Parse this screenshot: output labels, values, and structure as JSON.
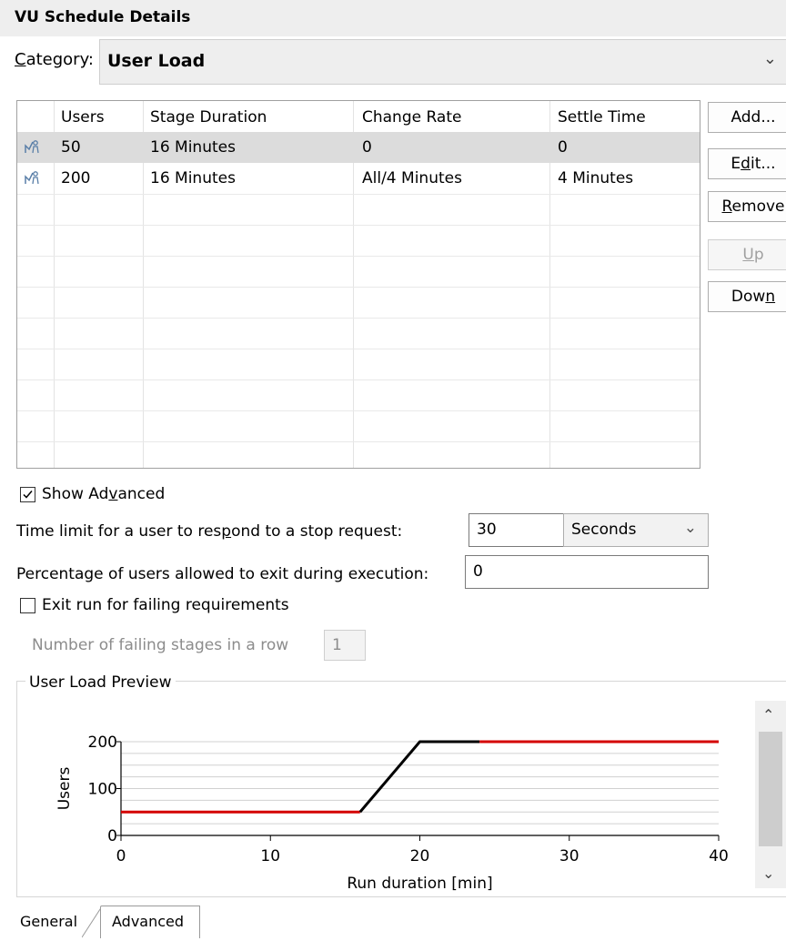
{
  "header": {
    "title": "VU Schedule Details"
  },
  "category": {
    "label": "Category:",
    "value": "User Load"
  },
  "table": {
    "columns": [
      "Users",
      "Stage Duration",
      "Change Rate",
      "Settle Time"
    ],
    "rows": [
      {
        "users": "50",
        "duration": "16 Minutes",
        "change_rate": "0",
        "settle": "0",
        "selected": true
      },
      {
        "users": "200",
        "duration": "16 Minutes",
        "change_rate": "All/4 Minutes",
        "settle": "4 Minutes",
        "selected": false
      }
    ]
  },
  "buttons": {
    "add": "Add...",
    "edit": "Edit...",
    "remove": "Remove",
    "up": "Up",
    "down": "Down"
  },
  "advanced": {
    "show_advanced_label": "Show Advanced",
    "show_advanced_checked": true,
    "stop_time_label": "Time limit for a user to respond to a stop request:",
    "stop_time_value": "30",
    "stop_time_unit": "Seconds",
    "exit_pct_label": "Percentage of users allowed to exit during execution:",
    "exit_pct_value": "0",
    "exit_failing_label": "Exit run for failing requirements",
    "exit_failing_checked": false,
    "failing_stages_label": "Number of failing stages in a row",
    "failing_stages_value": "1"
  },
  "preview": {
    "title": "User Load Preview",
    "scroll_up": "^",
    "scroll_down": "v"
  },
  "chart_data": {
    "type": "line",
    "ylabel": "Users",
    "xlabel": "Run duration [min]",
    "x_ticks": [
      "0",
      "10",
      "20",
      "30",
      "40"
    ],
    "y_ticks": [
      "0",
      "100",
      "200"
    ],
    "xlim": [
      0,
      40
    ],
    "ylim": [
      0,
      200
    ],
    "grid": true,
    "series": [
      {
        "color": "#d40000",
        "points": [
          [
            0,
            50
          ],
          [
            16,
            50
          ]
        ]
      },
      {
        "color": "#000000",
        "points": [
          [
            16,
            50
          ],
          [
            20,
            200
          ],
          [
            24,
            200
          ]
        ]
      },
      {
        "color": "#d40000",
        "points": [
          [
            24,
            200
          ],
          [
            40,
            200
          ]
        ]
      }
    ]
  },
  "tabs": {
    "general": "General",
    "advanced": "Advanced"
  }
}
